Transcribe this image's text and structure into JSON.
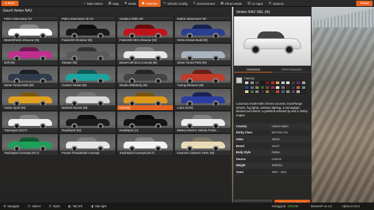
{
  "topbar": {
    "back_label": "Back",
    "pause_label": "Pause",
    "tabs": [
      {
        "label": "Main Menu",
        "icon": "home-icon",
        "active": false
      },
      {
        "label": "Map",
        "icon": "map-icon",
        "active": false
      },
      {
        "label": "Mods",
        "icon": "puzzle-icon",
        "active": false
      },
      {
        "label": "Vehicles",
        "icon": "car-icon",
        "active": true
      },
      {
        "label": "Vehicle Config",
        "icon": "wrench-icon",
        "active": false
      },
      {
        "label": "Environment",
        "icon": "sun-icon",
        "active": false
      },
      {
        "label": "Photo Mode",
        "icon": "camera-icon",
        "active": false
      },
      {
        "label": "UI Apps",
        "icon": "apps-icon",
        "active": false
      },
      {
        "label": "Options",
        "icon": "gear-icon",
        "active": false
      }
    ]
  },
  "list": {
    "title": "Gavril Vertex NA2",
    "top_row": [
      "Police Interceptor (A)",
      "Police Interceptor Alt (A)",
      "Amateur Rally (M)",
      "Daikon Motorsport (M)"
    ],
    "cards": [
      {
        "label": "BeamWheels Showcar (M)",
        "color": "#ffffff"
      },
      {
        "label": "FusionSD Showcar (M)",
        "color": "#1a1a1a"
      },
      {
        "label": "FusionSD SES Showcar (M)",
        "color": "#c0141c"
      },
      {
        "label": "Vertex Dream Build (M)",
        "color": "#2a3f8f"
      },
      {
        "label": "Drift (M)",
        "color": "#c22e8f"
      },
      {
        "label": "Sleeper (M)",
        "color": "#5a5a5a"
      },
      {
        "label": "BeamCraft BC2 Concept (M)",
        "color": "#e8e8e8"
      },
      {
        "label": "Street Tuned FWD (M)",
        "color": "#a9b4c0"
      },
      {
        "label": "Street Tuned AWD (M)",
        "color": "#2f3a4a"
      },
      {
        "label": "Custom Sedan (M)",
        "color": "#1aa5a0"
      },
      {
        "label": "Okuda Widebody (M)",
        "color": "#444444"
      },
      {
        "label": "Tuning Showcar (M)",
        "color": "#c23a2a"
      },
      {
        "label": "Vertex Sport (M)",
        "color": "#e0a020"
      },
      {
        "label": "Murkish Muscle (M)",
        "color": "#d8d8d8"
      },
      {
        "label": "Drift (M)",
        "color": "#e09a1a",
        "selected": true
      },
      {
        "label": "Lotus (SVD)",
        "color": "#2b3fa0"
      },
      {
        "label": "TrackSport (DCT)",
        "color": "#f0f0f0"
      },
      {
        "label": "RoadSport (M)",
        "color": "#1c1c1c"
      },
      {
        "label": "RoadSport (A)",
        "color": "#151515"
      },
      {
        "label": "Battery Electric Vehicle Protot...",
        "color": "#ececec"
      },
      {
        "label": "TrackSport Concept (DCT)",
        "color": "#1fa05a"
      },
      {
        "label": "Frozen Thunderbolt Concept",
        "color": "#e6e6e6"
      },
      {
        "label": "TrackSport Concept (DCT)",
        "color": "#f2f2f2"
      },
      {
        "label": "Innocent Customs VIGIL (M)",
        "color": "#e9dcb5"
      }
    ]
  },
  "detail": {
    "title": "Vertex NA2 SEL (A)",
    "tab_overview": "OVERVIEW",
    "tab_performance": "PERFORMANCE",
    "factory_label": "Factory:",
    "swatches": [
      "#c8c8c8",
      "#8d8d8d",
      "#4a4a4a",
      "#1a1a1a",
      "#7d1d1d",
      "#b03030",
      "#d0a050",
      "#b8bfc5",
      "#d8d8d8",
      "#3d3d3d",
      "#6a2a70",
      "#a0a0a0",
      "#2a4a80",
      "#5a6a7a",
      "#8a8a4a",
      "#3a5a3a",
      "#6a4a2a",
      "#9a2a4a",
      "#e0e0e0",
      "#707070",
      "#4a2a2a",
      "#2a3a5a",
      "#c06030",
      "#5a8a9a",
      "#e0d0a0",
      "#4a6a4a",
      "#808080",
      "#3a2a4a",
      "#a07040",
      "#1a3a2a",
      "#d04040",
      "#406080",
      "#909070",
      "#604060",
      "#b0b0b0",
      "#282828"
    ],
    "description": "Luxurious model with chrome accents, EuroFlange wheels, fog lights, ambient lighting, a domeglight, decked out interior, a polished exhaust tip and a 150hp engine",
    "specs": [
      {
        "key": "Country",
        "value": "United States"
      },
      {
        "key": "Derby Class",
        "value": "Mid-Size Car"
      },
      {
        "key": "Value",
        "value": "19615"
      },
      {
        "key": "Brand",
        "value": "Gavril"
      },
      {
        "key": "Body Style",
        "value": "Sedan"
      },
      {
        "key": "Source",
        "value": "Custom"
      },
      {
        "key": "Weight",
        "value": "2068 lbs"
      },
      {
        "key": "Years",
        "value": "2007 - 2011"
      }
    ],
    "spawn_label": "SPAWN NEW",
    "replace_label": "REPLACE CURRENT"
  },
  "bottombar": {
    "hints": [
      {
        "label": "Navigate",
        "icon": "dpad-icon"
      },
      {
        "label": "Select",
        "icon": "a-button-icon"
      },
      {
        "label": "Back",
        "icon": "b-button-icon"
      },
      {
        "label": "Tab left",
        "icon": "lb-button-icon"
      },
      {
        "label": "Tab right",
        "icon": "rb-button-icon"
      }
    ],
    "network": "Nologgical",
    "online": "ONLINE",
    "version": "BeamMP v4.4.0",
    "alpha": "Alpha v0.25.5"
  }
}
